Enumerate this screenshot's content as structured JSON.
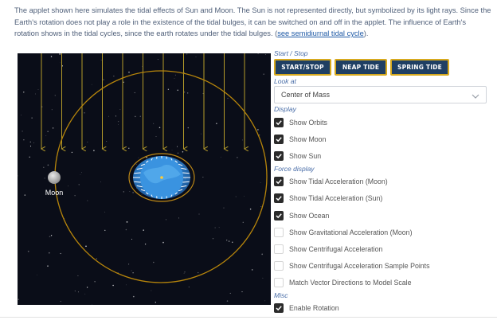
{
  "intro": {
    "text": "The applet shown here simulates the tidal effects of Sun and Moon. The Sun is not represented directly, but symbolized by its light rays. Since the Earth's rotation does not play a role in the existence of the tidal bulges, it can be switched on and off in the applet. The influence of Earth's rotation shows in the tidal cycles, since the earth rotates under the tidal bulges. (",
    "link": "see semidiurnal tidal cycle",
    "tail": ")."
  },
  "simulation": {
    "moon_label": "Moon",
    "colors": {
      "background": "#0a0d18",
      "sun_rays": "#b49a2a",
      "orbit": "#b8860b",
      "earth_ocean": "#2f86d6",
      "force_vectors": "#ffffff"
    }
  },
  "controls": {
    "start_stop": {
      "label": "Start / Stop",
      "buttons": [
        "START/STOP",
        "NEAP TIDE",
        "SPRING TIDE"
      ]
    },
    "look_at": {
      "label": "Look at",
      "selected": "Center of Mass"
    },
    "display": {
      "label": "Display",
      "items": [
        {
          "label": "Show Orbits",
          "checked": true
        },
        {
          "label": "Show Moon",
          "checked": true
        },
        {
          "label": "Show Sun",
          "checked": true
        }
      ]
    },
    "force_display": {
      "label": "Force display",
      "items": [
        {
          "label": "Show Tidal Acceleration (Moon)",
          "checked": true
        },
        {
          "label": "Show Tidal Acceleration (Sun)",
          "checked": true
        },
        {
          "label": "Show Ocean",
          "checked": true
        },
        {
          "label": "Show Gravitational Acceleration (Moon)",
          "checked": false
        },
        {
          "label": "Show Centrifugal Acceleration",
          "checked": false
        },
        {
          "label": "Show Centrifugal Acceleration Sample Points",
          "checked": false
        },
        {
          "label": "Match Vector Directions to Model Scale",
          "checked": false
        }
      ]
    },
    "misc": {
      "label": "Misc",
      "items": [
        {
          "label": "Enable Rotation",
          "checked": true
        }
      ]
    }
  }
}
